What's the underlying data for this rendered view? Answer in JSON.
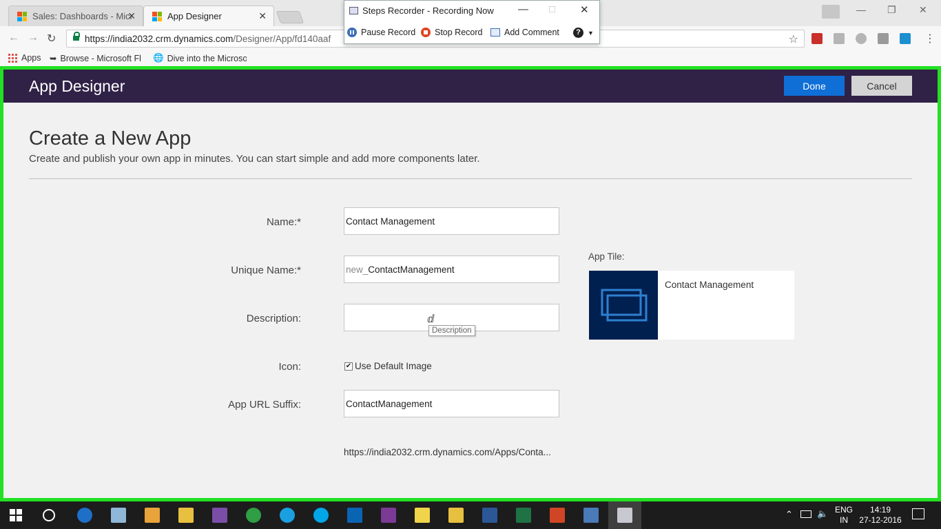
{
  "browser": {
    "tabs": [
      {
        "label": "Sales: Dashboards - Micr",
        "active": false
      },
      {
        "label": "App Designer",
        "active": true
      }
    ],
    "close_glyph": "✕",
    "url_host": "https://india2032.crm.dynamics.com",
    "url_path": "/Designer/App/fd140aaf",
    "bookmarks": [
      {
        "label": "Apps",
        "icon": "apps-grid-icon"
      },
      {
        "label": "Browse - Microsoft Fl",
        "icon": "flow-icon"
      },
      {
        "label": "Dive into the Microso",
        "icon": "globe-icon"
      }
    ]
  },
  "steps_recorder": {
    "title": "Steps Recorder - Recording Now",
    "pause": "Pause Record",
    "stop": "Stop Record",
    "comment": "Add Comment",
    "help": "?"
  },
  "app_designer": {
    "header_title": "App Designer",
    "done_label": "Done",
    "cancel_label": "Cancel",
    "page_title": "Create a New App",
    "page_subtitle": "Create and publish your own app in minutes. You can start simple and add more components later.",
    "fields": {
      "name_label": "Name:*",
      "name_value": "Contact Management",
      "unique_label": "Unique Name:*",
      "unique_prefix": "new_",
      "unique_value": "ContactManagement",
      "description_label": "Description:",
      "description_value": "",
      "description_tooltip": "Description",
      "icon_label": "Icon:",
      "icon_checkbox_label": "Use Default Image",
      "icon_checked": true,
      "url_suffix_label": "App URL Suffix:",
      "url_suffix_value": "ContactManagement",
      "url_preview": "https://india2032.crm.dynamics.com/Apps/Conta..."
    },
    "tile": {
      "label": "App Tile:",
      "name": "Contact Management",
      "icon_color": "#002050"
    },
    "colors": {
      "header": "#302147",
      "done": "#0f6fd7",
      "recording_frame": "#22e022"
    }
  },
  "taskbar": {
    "lang_top": "ENG",
    "lang_bottom": "IN",
    "time": "14:19",
    "date": "27-12-2016"
  }
}
